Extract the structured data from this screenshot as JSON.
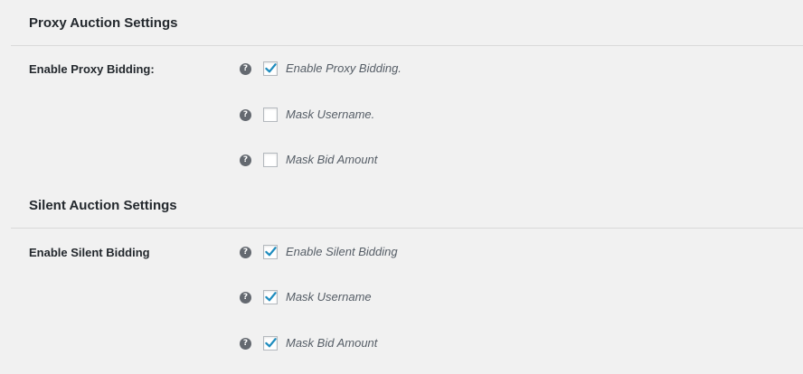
{
  "proxy": {
    "title": "Proxy Auction Settings",
    "row_label": "Enable Proxy Bidding:",
    "options": [
      {
        "label": "Enable Proxy Bidding.",
        "checked": true
      },
      {
        "label": "Mask Username.",
        "checked": false
      },
      {
        "label": "Mask Bid Amount",
        "checked": false
      }
    ]
  },
  "silent": {
    "title": "Silent Auction Settings",
    "row_label": "Enable Silent Bidding",
    "options": [
      {
        "label": "Enable Silent Bidding",
        "checked": true
      },
      {
        "label": "Mask Username",
        "checked": true
      },
      {
        "label": "Mask Bid Amount",
        "checked": true
      }
    ]
  },
  "help_glyph": "?",
  "colors": {
    "background": "#f1f1f1",
    "check": "#1e8cbe",
    "help_icon": "#646970"
  }
}
